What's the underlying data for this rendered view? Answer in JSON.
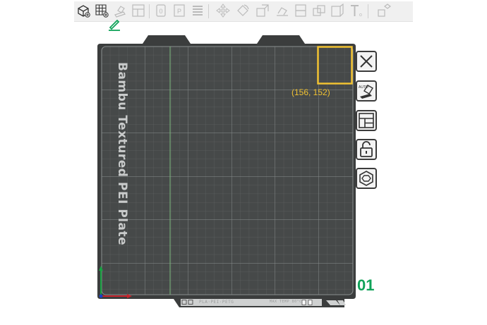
{
  "toolbar": {
    "icons": [
      "add-object-icon",
      "add-plate-icon",
      "auto-orient-icon",
      "arrange-icon",
      "split-objects-icon",
      "split-parts-icon",
      "layers-icon",
      "move-icon",
      "rotate-icon",
      "scale-icon",
      "lay-on-face-icon",
      "cut-icon",
      "boolean-icon",
      "measure-icon",
      "text-icon",
      "assembly-icon"
    ]
  },
  "plate": {
    "name": "Bambu Textured PEI Plate",
    "number": "01",
    "selection_coords": "(156, 152)",
    "bottom_text_left": "PLA·PEI·PETG",
    "bottom_text_right": "MAX TEMP 80°C",
    "colors": {
      "bed": "#464949",
      "frame": "#3b3d3d",
      "grid": "#6f7474",
      "accent_x_line": "#7ab87a",
      "selection": "#f1c232",
      "plate_number": "#11a35a"
    }
  },
  "side_buttons": [
    {
      "name": "close-plate-button",
      "icon": "close-icon"
    },
    {
      "name": "auto-arrange-button",
      "icon": "auto-orient-icon"
    },
    {
      "name": "arrange-plate-button",
      "icon": "layout-icon"
    },
    {
      "name": "lock-plate-button",
      "icon": "unlock-icon"
    },
    {
      "name": "plate-settings-button",
      "icon": "hex-nut-icon"
    }
  ]
}
